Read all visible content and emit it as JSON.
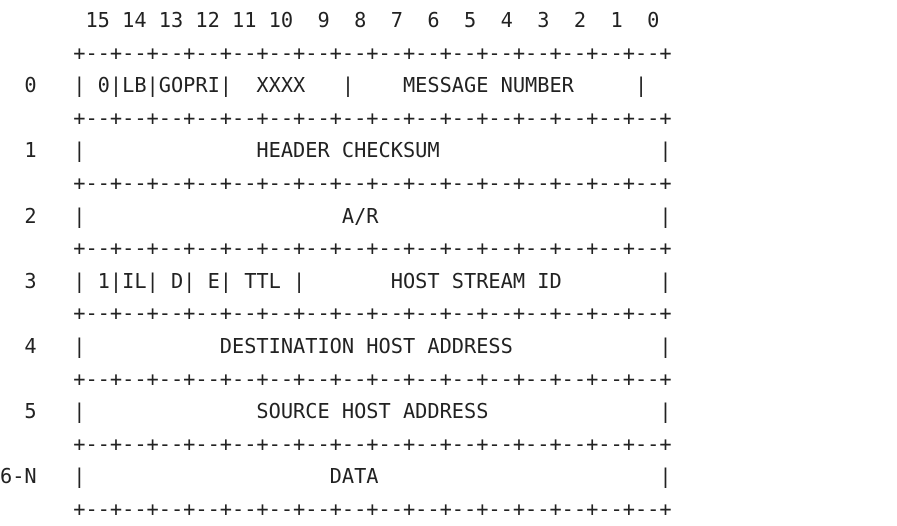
{
  "diagram": {
    "lines": [
      "       15 14 13 12 11 10  9  8  7  6  5  4  3  2  1  0",
      "      +--+--+--+--+--+--+--+--+--+--+--+--+--+--+--+--+",
      "  0   | 0|LB|GOPRI|  XXXX   |    MESSAGE NUMBER     |",
      "      +--+--+--+--+--+--+--+--+--+--+--+--+--+--+--+--+",
      "  1   |              HEADER CHECKSUM                  |",
      "      +--+--+--+--+--+--+--+--+--+--+--+--+--+--+--+--+",
      "  2   |                     A/R                       |",
      "      +--+--+--+--+--+--+--+--+--+--+--+--+--+--+--+--+",
      "  3   | 1|IL| D| E| TTL |       HOST STREAM ID        |",
      "      +--+--+--+--+--+--+--+--+--+--+--+--+--+--+--+--+",
      "  4   |           DESTINATION HOST ADDRESS            |",
      "      +--+--+--+--+--+--+--+--+--+--+--+--+--+--+--+--+",
      "  5   |              SOURCE HOST ADDRESS              |",
      "      +--+--+--+--+--+--+--+--+--+--+--+--+--+--+--+--+",
      "6-N   |                    DATA                       |",
      "      +--+--+--+--+--+--+--+--+--+--+--+--+--+--+--+--+"
    ]
  }
}
